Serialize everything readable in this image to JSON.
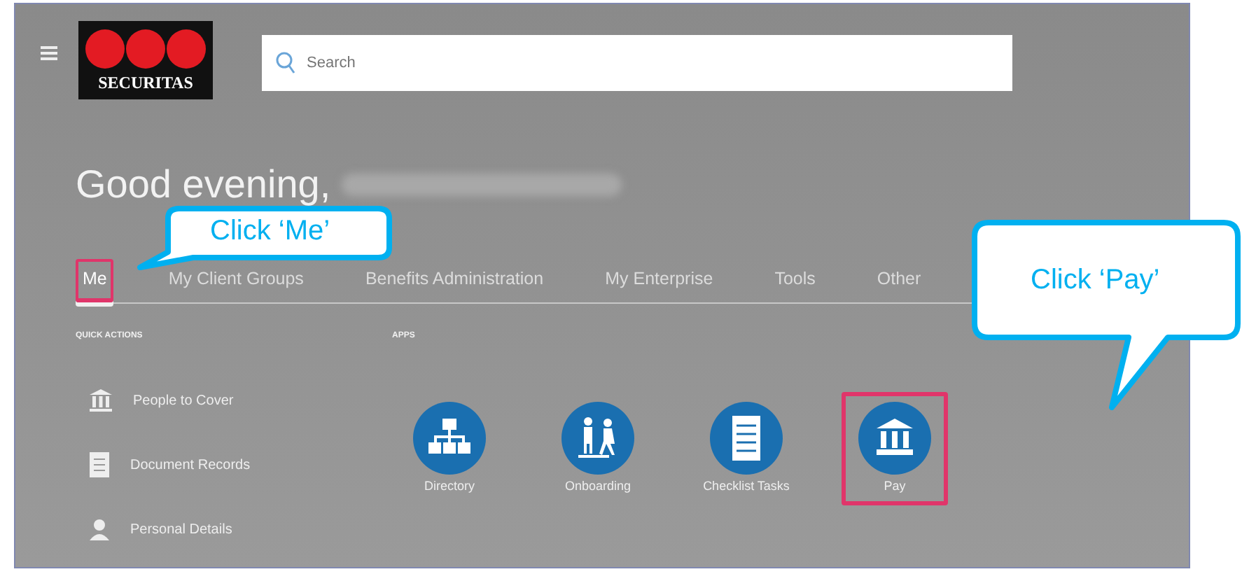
{
  "header": {
    "logo": "SECURITAS",
    "search": {
      "placeholder": "Search"
    }
  },
  "greeting": "Good evening,",
  "tabs": [
    {
      "label": "Me",
      "selected": true,
      "highlighted": true
    },
    {
      "label": "My Client Groups",
      "selected": false,
      "highlighted": false
    },
    {
      "label": "Benefits Administration",
      "selected": false,
      "highlighted": false
    },
    {
      "label": "My Enterprise",
      "selected": false,
      "highlighted": false
    },
    {
      "label": "Tools",
      "selected": false,
      "highlighted": false
    },
    {
      "label": "Other",
      "selected": false,
      "highlighted": false
    }
  ],
  "quick_actions": {
    "title": "QUICK ACTIONS",
    "items": [
      {
        "label": "People to Cover",
        "kind": "bank"
      },
      {
        "label": "Document Records",
        "kind": "document"
      },
      {
        "label": "Personal Details",
        "kind": "person"
      }
    ]
  },
  "apps": {
    "title": "APPS",
    "items": [
      {
        "label": "Directory",
        "kind": "org",
        "highlighted": false
      },
      {
        "label": "Onboarding",
        "kind": "people",
        "highlighted": false
      },
      {
        "label": "Checklist Tasks",
        "kind": "checklist",
        "highlighted": false
      },
      {
        "label": "Pay",
        "kind": "bank",
        "highlighted": true
      }
    ]
  },
  "annotations": [
    {
      "text": "Click ‘Me’",
      "kind": "tab"
    },
    {
      "text": "Click ‘Pay’",
      "kind": "app"
    }
  ]
}
